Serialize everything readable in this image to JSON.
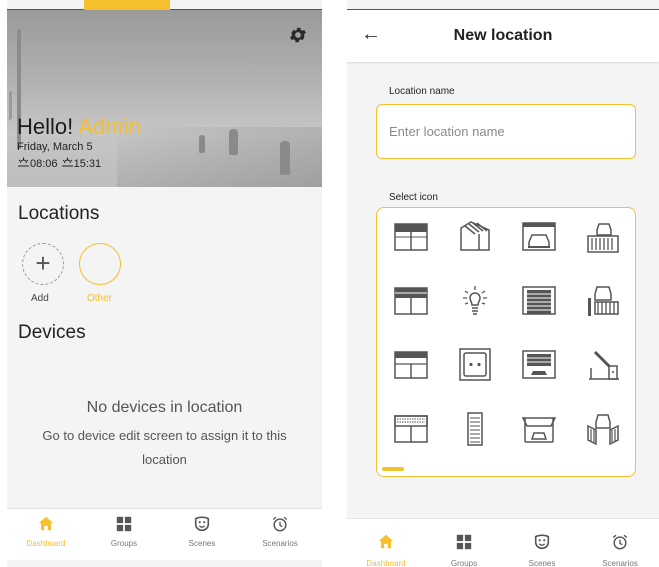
{
  "left": {
    "greeting": "Hello!",
    "user": "Admin",
    "date": "Friday, March 5",
    "sunrise": "08:06",
    "sunset": "15:31",
    "locations_title": "Locations",
    "locations": [
      {
        "label": "Add"
      },
      {
        "label": "Other"
      }
    ],
    "devices_title": "Devices",
    "empty_title": "No devices in location",
    "empty_text": "Go to device edit screen to assign it to this location"
  },
  "right": {
    "title": "New location",
    "name_label": "Location name",
    "name_placeholder": "Enter location name",
    "name_value": "",
    "icon_label": "Select icon",
    "icons": [
      "window-blind-icon",
      "awning-icon",
      "garage-car-icon",
      "gate-car-icon",
      "window-blind-double-icon",
      "light-bulb-icon",
      "garage-door-icon",
      "gate-car-fence-icon",
      "window-awning-icon",
      "socket-icon",
      "garage-open-icon",
      "barrier-gate-icon",
      "window-shutter-icon",
      "vertical-blind-icon",
      "canopy-garage-icon",
      "double-gate-car-icon"
    ]
  },
  "nav": [
    {
      "label": "Dashboard",
      "icon": "home-icon",
      "active": true
    },
    {
      "label": "Groups",
      "icon": "grid-icon",
      "active": false
    },
    {
      "label": "Scenes",
      "icon": "theater-mask-icon",
      "active": false
    },
    {
      "label": "Scenarios",
      "icon": "alarm-clock-icon",
      "active": false
    }
  ],
  "colors": {
    "accent": "#f5bf2d",
    "background": "#f4f4f4"
  }
}
